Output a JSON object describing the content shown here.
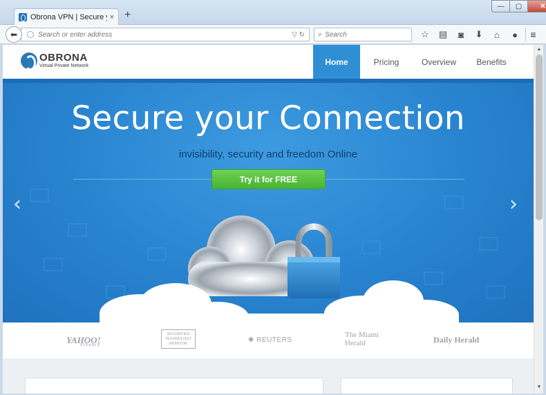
{
  "browser": {
    "tab_title": "Obrona VPN | Secure your ...",
    "tab_close": "×",
    "new_tab": "+",
    "url_placeholder": "Search or enter address",
    "search_placeholder": "Search",
    "window_controls": {
      "minimize": "—",
      "maximize": "▢",
      "close": "✕"
    },
    "toolbar_icons": [
      "star-icon",
      "reading-list-icon",
      "pocket-icon",
      "download-icon",
      "home-icon",
      "chat-icon"
    ]
  },
  "site": {
    "logo": {
      "name": "OBRONA",
      "tagline": "Virtual Private Network"
    },
    "nav": {
      "home": "Home",
      "pricing": "Pricing",
      "overview": "Overview",
      "benefits": "Benefits"
    },
    "hero": {
      "title": "Secure your Connection",
      "subtitle": "invisibility, security and freedom Online",
      "cta": "Try it for FREE",
      "prev": "‹",
      "next": "›"
    },
    "press": {
      "yahoo": "YAHOO!",
      "yahoo_sub": "FINANCE",
      "stm": "SECURITIES TECHNOLOGY MONITOR",
      "reuters": "REUTERS",
      "miami": "The Miami Herald",
      "daily": "Daily Herald"
    }
  },
  "colors": {
    "nav_active": "#2e8fd4",
    "hero_blue": "#2883cf",
    "cta_green": "#5cc444",
    "subtitle_text": "#0f3f6e"
  }
}
